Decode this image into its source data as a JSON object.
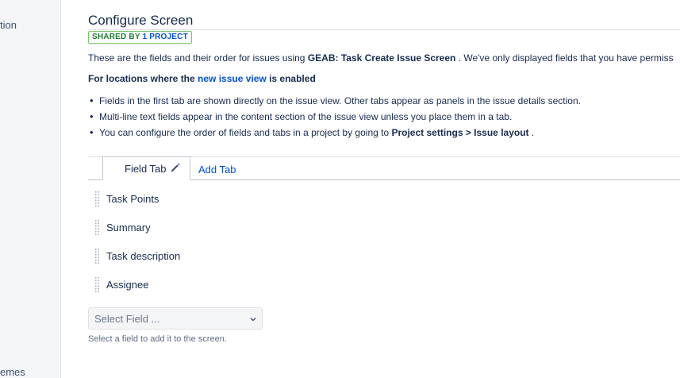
{
  "sidebar": {
    "top_item": "tion",
    "bottom_item": "emes"
  },
  "page": {
    "title": "Configure Screen",
    "badge": {
      "prefix": "SHARED BY ",
      "link": "1 PROJECT"
    },
    "intro": {
      "before": "These are the fields and their order for issues using ",
      "screen_name": "GEAB: Task Create Issue Screen",
      "after": " . We've only displayed fields that you have permiss"
    },
    "locations": {
      "before": "For locations where the ",
      "link": "new issue view",
      "after": " is enabled"
    },
    "bullets": {
      "b1": "Fields in the first tab are shown directly on the issue view. Other tabs appear as panels in the issue details section.",
      "b2": "Multi-line text fields appear in the content section of the issue view unless you place them in a tab.",
      "b3_before": "You can configure the order of fields and tabs in a project by going to ",
      "b3_bold": "Project settings > Issue layout",
      "b3_after": " ."
    }
  },
  "tabs": {
    "active_label": "Field Tab",
    "add_label": "Add Tab"
  },
  "fields": [
    {
      "label": "Task Points"
    },
    {
      "label": "Summary"
    },
    {
      "label": "Task description"
    },
    {
      "label": "Assignee"
    }
  ],
  "select": {
    "placeholder": "Select Field ...",
    "helper": "Select a field to add it to the screen."
  },
  "icons": {
    "edit": "pencil-icon",
    "drag": "drag-handle-icon",
    "dropdown": "chevron-down-icon"
  },
  "colors": {
    "link": "#0052cc",
    "text": "#172b4d",
    "badge_border": "#79c56a",
    "badge_text": "#1e7a34"
  }
}
